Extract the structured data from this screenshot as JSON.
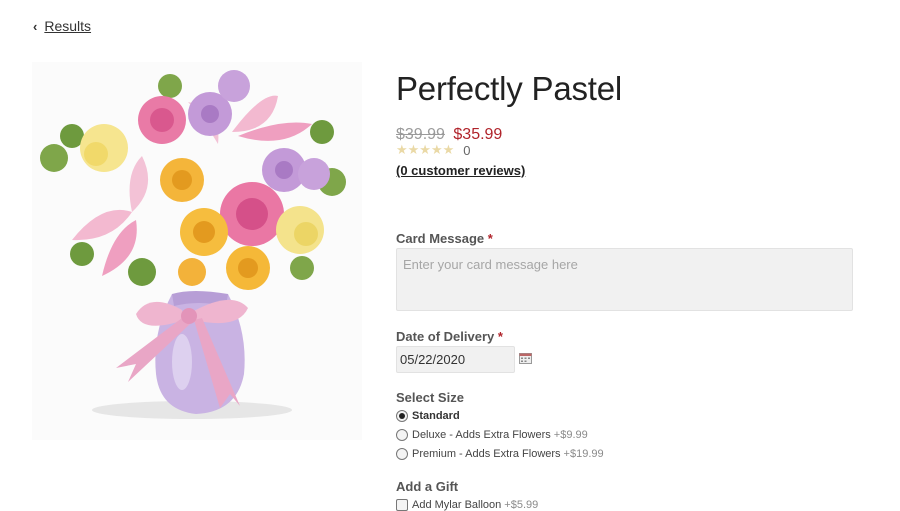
{
  "nav": {
    "back_label": "Results"
  },
  "product": {
    "title": "Perfectly Pastel",
    "original_price": "$39.99",
    "sale_price": "$35.99",
    "rating_stars": "★★★★★",
    "rating_value": 0,
    "rating_count": "0",
    "reviews_link": "(0 customer reviews)"
  },
  "card_message": {
    "label": "Card Message",
    "required_mark": "*",
    "placeholder": "Enter your card message here"
  },
  "delivery": {
    "label": "Date of Delivery",
    "required_mark": "*",
    "value": "05/22/2020"
  },
  "size": {
    "label": "Select Size",
    "options": [
      {
        "label": "Standard",
        "price": "",
        "selected": true
      },
      {
        "label": "Deluxe - Adds Extra Flowers",
        "price": "+$9.99",
        "selected": false
      },
      {
        "label": "Premium - Adds Extra Flowers",
        "price": "+$19.99",
        "selected": false
      }
    ]
  },
  "gift": {
    "label": "Add a Gift",
    "options": [
      {
        "label": "Add Mylar Balloon",
        "price": "+$5.99",
        "checked": false
      }
    ]
  },
  "colors": {
    "sale_price": "#b0232a",
    "required": "#b0232a",
    "input_bg": "#f1f1f1"
  }
}
